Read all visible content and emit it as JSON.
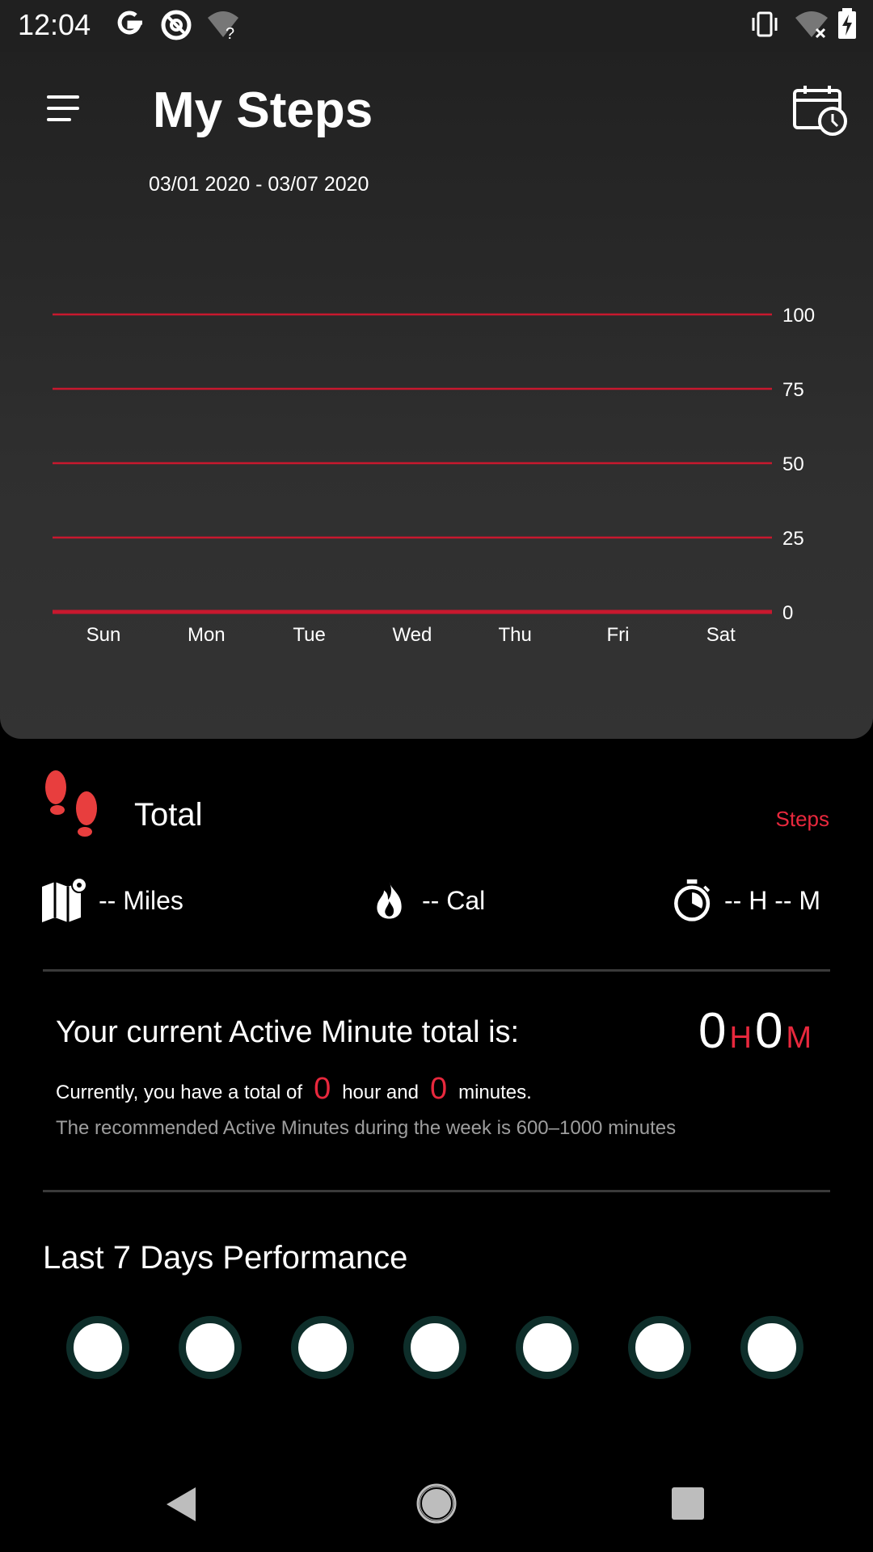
{
  "status_bar": {
    "time": "12:04",
    "left_icons": [
      "google-icon",
      "at-sync-icon",
      "wifi-unknown-icon"
    ],
    "right_icons": [
      "vibrate-icon",
      "wifi-off-icon",
      "battery-charging-icon"
    ]
  },
  "header": {
    "title": "My Steps",
    "date_range": "03/01 2020 - 03/07 2020",
    "menu_icon": "menu-icon",
    "calendar_icon": "calendar-clock-icon"
  },
  "chart_data": {
    "type": "bar",
    "categories": [
      "Sun",
      "Mon",
      "Tue",
      "Wed",
      "Thu",
      "Fri",
      "Sat"
    ],
    "values": [
      0,
      0,
      0,
      0,
      0,
      0,
      0
    ],
    "title": "",
    "xlabel": "",
    "ylabel": "",
    "ylim": [
      0,
      100
    ],
    "yticks": [
      "0",
      "25",
      "50",
      "75",
      "100"
    ],
    "grid": true,
    "grid_color": "#c8182e"
  },
  "totals": {
    "label": "Total",
    "unit": "Steps",
    "miles": "-- Miles",
    "calories": "-- Cal",
    "time": "-- H -- M"
  },
  "active_minutes": {
    "title": "Your current Active Minute total is:",
    "hours": "0",
    "hours_unit": "H",
    "minutes": "0",
    "minutes_unit": "M",
    "line_prefix": "Currently, you have a total of",
    "line_hours": "0",
    "line_mid": "hour and",
    "line_minutes": "0",
    "line_suffix": "minutes.",
    "recommendation": "The recommended Active Minutes during the week is 600–1000 minutes"
  },
  "performance": {
    "title": "Last 7 Days Performance",
    "days": 7
  },
  "colors": {
    "accent": "#e8283d",
    "card_bg": "#2a2a2a",
    "dot_ring": "#0e2e2a"
  },
  "nav_bar": {
    "icons": [
      "back-icon",
      "home-icon",
      "recents-icon"
    ]
  }
}
